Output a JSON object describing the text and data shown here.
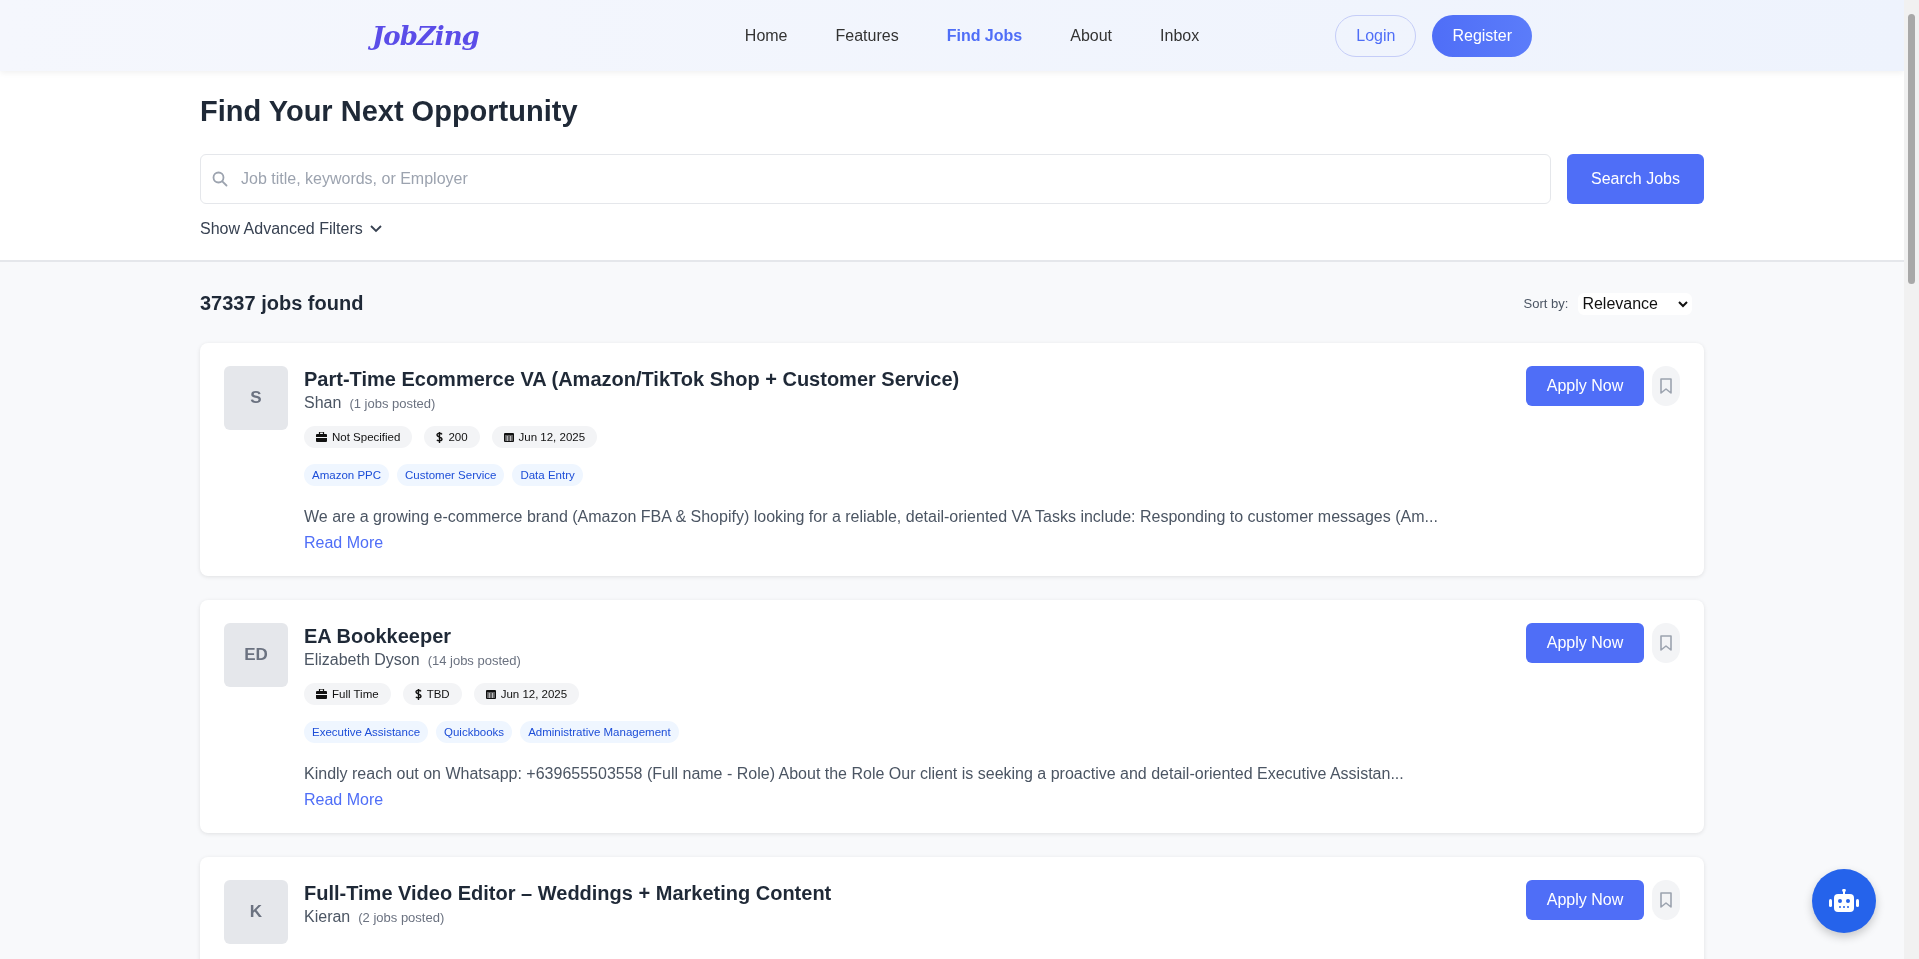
{
  "header": {
    "logo": "JobZing",
    "nav": [
      {
        "label": "Home",
        "selected": false
      },
      {
        "label": "Features",
        "selected": false
      },
      {
        "label": "Find Jobs",
        "selected": true
      },
      {
        "label": "About",
        "selected": false
      },
      {
        "label": "Inbox",
        "selected": false
      }
    ],
    "login": "Login",
    "register": "Register"
  },
  "search": {
    "title": "Find Your Next Opportunity",
    "placeholder": "Job title, keywords, or Employer",
    "button": "Search Jobs",
    "advanced": "Show Advanced Filters"
  },
  "results": {
    "count": "37337 jobs found",
    "sort_label": "Sort by:",
    "sort_value": "Relevance"
  },
  "jobs": [
    {
      "initials": "S",
      "title": "Part-Time Ecommerce VA (Amazon/TikTok Shop + Customer Service)",
      "company": "Shan",
      "posted": "(1 jobs posted)",
      "type": "Not Specified",
      "pay": "200",
      "date": "Jun 12, 2025",
      "tags": [
        "Amazon PPC",
        "Customer Service",
        "Data Entry"
      ],
      "description": "We are a growing e-commerce brand (Amazon FBA & Shopify) looking for a reliable, detail-oriented VA Tasks include: Responding to customer messages (Am...",
      "read_more": "Read More",
      "apply": "Apply Now",
      "saved": false
    },
    {
      "initials": "ED",
      "title": "EA Bookkeeper",
      "company": "Elizabeth Dyson",
      "posted": "(14 jobs posted)",
      "type": "Full Time",
      "pay": "TBD",
      "date": "Jun 12, 2025",
      "tags": [
        "Executive Assistance",
        "Quickbooks",
        "Administrative Management"
      ],
      "description": "Kindly reach out on Whatsapp: +639655503558 (Full name - Role) About the Role Our client is seeking a proactive and detail-oriented Executive Assistan...",
      "read_more": "Read More",
      "apply": "Apply Now",
      "saved": false
    },
    {
      "initials": "K",
      "title": "Full-Time Video Editor – Weddings + Marketing Content",
      "company": "Kieran",
      "posted": "(2 jobs posted)",
      "apply": "Apply Now",
      "saved": false
    }
  ]
}
